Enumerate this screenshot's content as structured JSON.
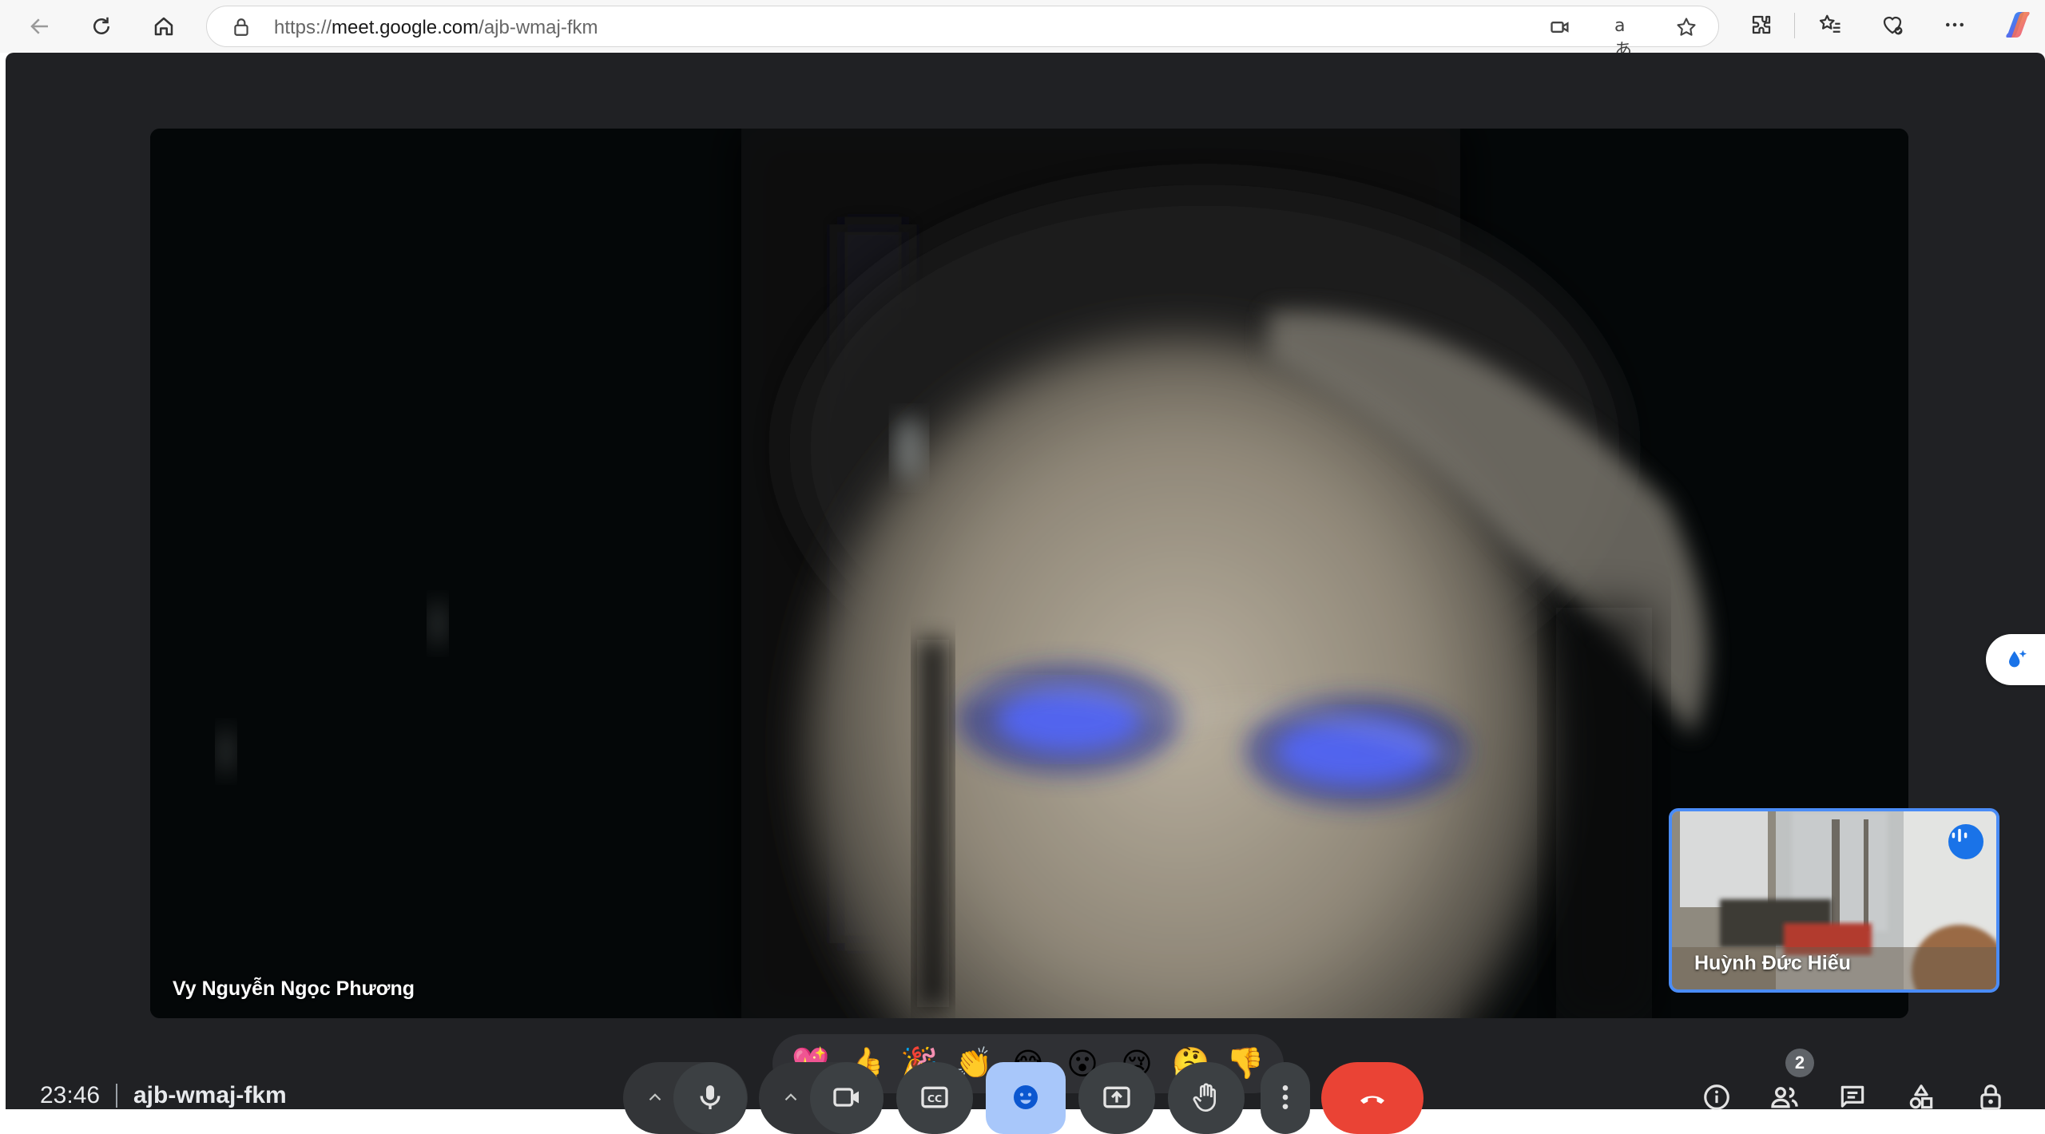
{
  "browser": {
    "url_prefix": "https://",
    "url_host": "meet.google.com",
    "url_path": "/ajb-wmaj-fkm",
    "read_aloud_glyph": "aあ"
  },
  "meeting": {
    "clock": "23:46",
    "code": "ajb-wmaj-fkm",
    "participant_count": "2"
  },
  "main_video": {
    "participant_name": "Vy Nguyễn Ngọc Phương"
  },
  "self_view": {
    "participant_name": "Huỳnh Đức Hiếu"
  },
  "reactions": [
    "💖",
    "👍",
    "🎉",
    "👏",
    "😂",
    "😮",
    "😢",
    "🤔",
    "👎"
  ],
  "colors": {
    "meet_background": "#202124",
    "active_tile_border": "#4a8cf7",
    "end_call": "#ea4335",
    "active_control": "#a8c7fa"
  }
}
